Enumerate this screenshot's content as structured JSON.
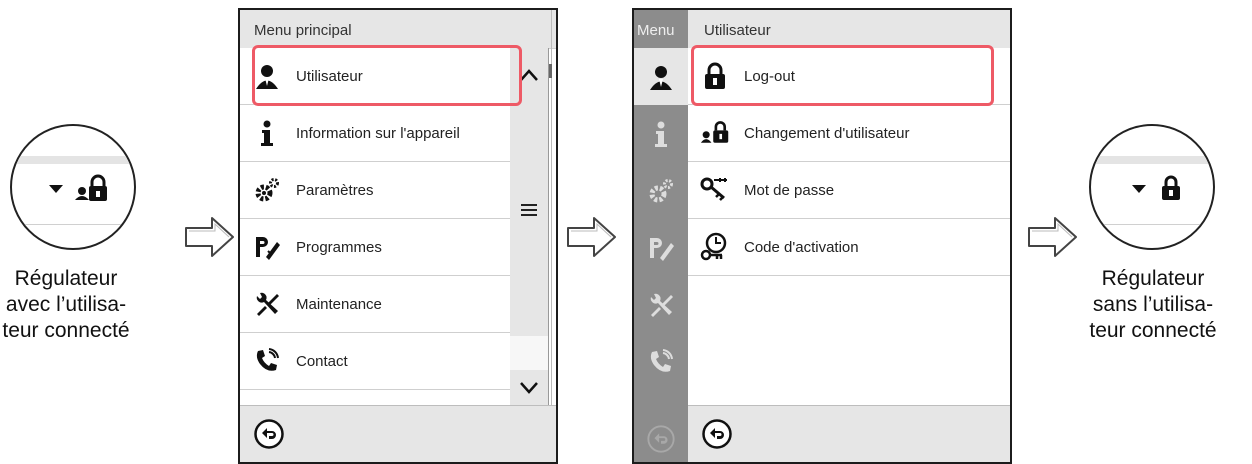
{
  "left_caption": {
    "line1": "Régulateur",
    "line2": "avec l’utilisa-",
    "line3": "teur connecté"
  },
  "right_caption": {
    "line1": "Régulateur",
    "line2": "sans l’utilisa-",
    "line3": "teur connecté"
  },
  "main_menu": {
    "title": "Menu principal",
    "items": [
      {
        "label": "Utilisateur",
        "icon": "user-icon"
      },
      {
        "label": "Information sur l'appareil",
        "icon": "info-icon"
      },
      {
        "label": "Paramètres",
        "icon": "gears-icon"
      },
      {
        "label": "Programmes",
        "icon": "programs-icon"
      },
      {
        "label": "Maintenance",
        "icon": "tools-icon"
      },
      {
        "label": "Contact",
        "icon": "phone-icon"
      }
    ],
    "highlighted_item": "Utilisateur"
  },
  "user_menu": {
    "sidebar_title": "Menu",
    "title": "Utilisateur",
    "items": [
      {
        "label": "Log-out",
        "icon": "padlock-closed-icon"
      },
      {
        "label": "Changement d'utilisateur",
        "icon": "user-switch-icon"
      },
      {
        "label": "Mot de passe",
        "icon": "key-icon"
      },
      {
        "label": "Code d'activation",
        "icon": "activation-code-icon"
      }
    ],
    "highlighted_item": "Log-out"
  },
  "colors": {
    "highlight": "#ee5a66",
    "header_bg": "#e6e6e6",
    "sidebar_bg": "#8c8c8c",
    "border": "#1c1c1c"
  }
}
